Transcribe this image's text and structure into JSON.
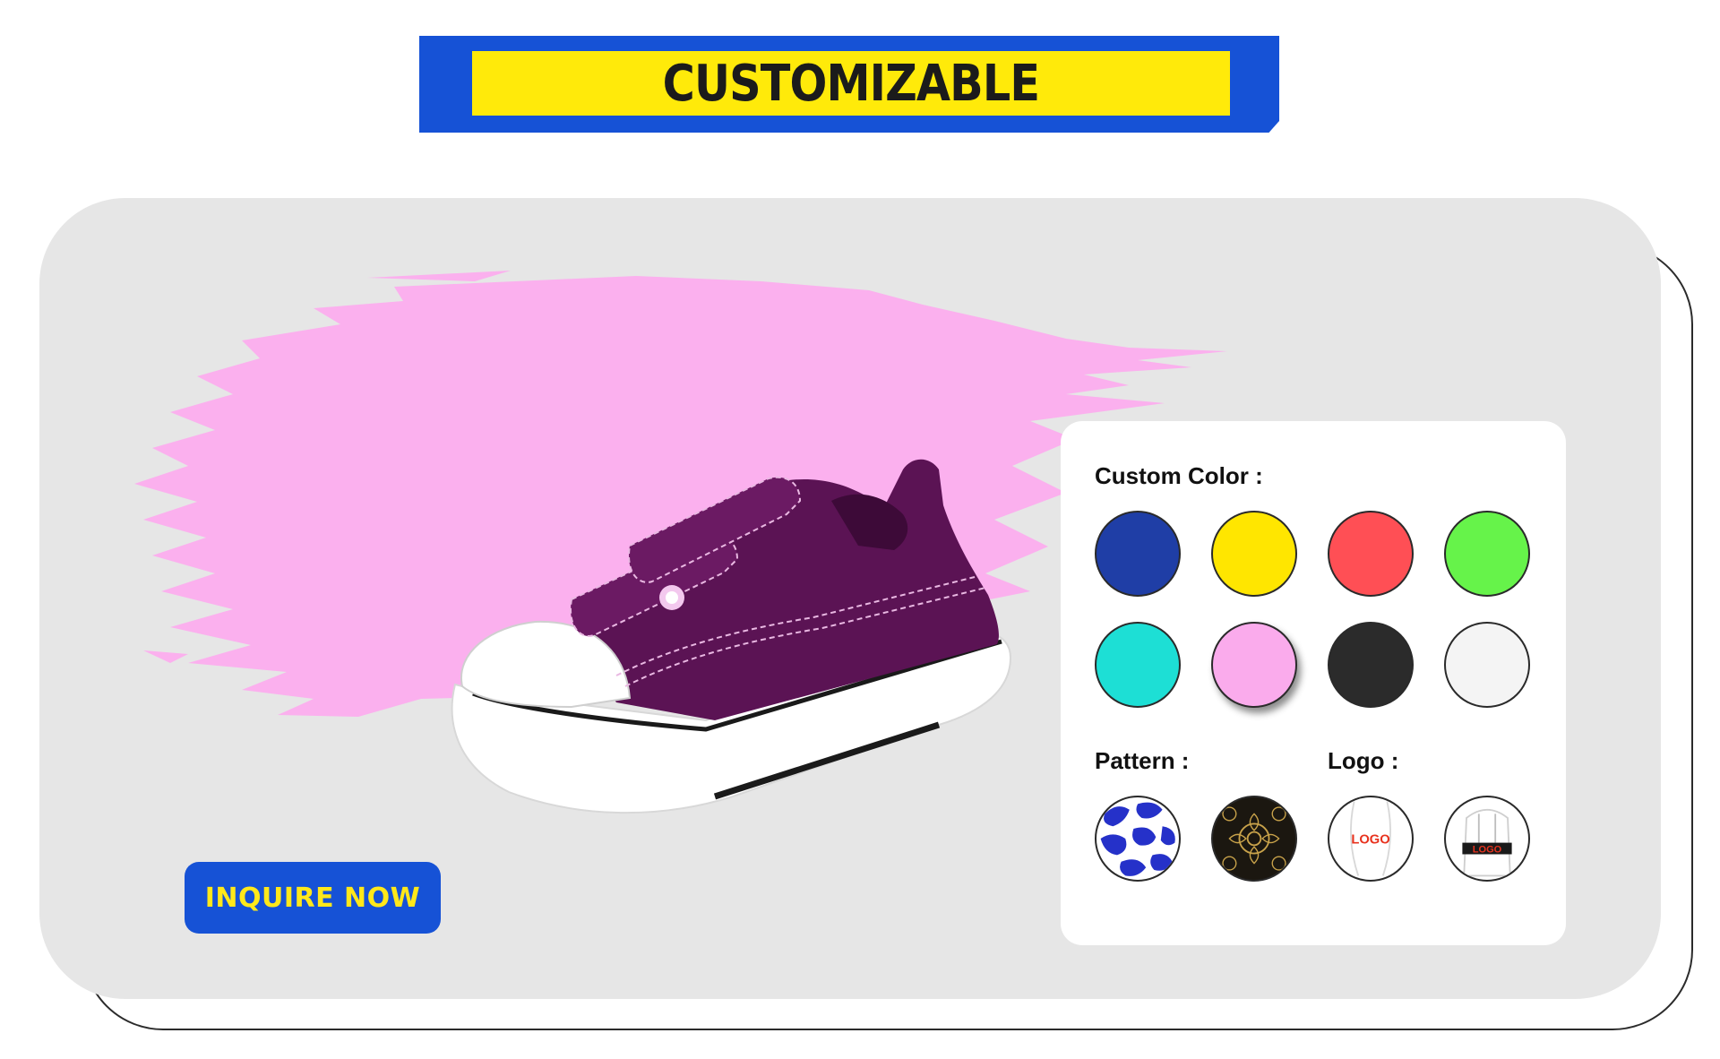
{
  "banner": {
    "title": "CUSTOMIZABLE"
  },
  "actions": {
    "inquire_label": "INQUIRE NOW"
  },
  "options": {
    "color_label": "Custom Color :",
    "colors": [
      {
        "name": "blue",
        "hex": "#1f3ea6"
      },
      {
        "name": "yellow",
        "hex": "#ffe600"
      },
      {
        "name": "red",
        "hex": "#ff4f55"
      },
      {
        "name": "green",
        "hex": "#66f34a"
      },
      {
        "name": "cyan",
        "hex": "#1ddfd5"
      },
      {
        "name": "pink",
        "hex": "#faabec",
        "selected": true
      },
      {
        "name": "black",
        "hex": "#2b2b2b"
      },
      {
        "name": "white",
        "hex": "#f4f4f4"
      }
    ],
    "pattern_label": "Pattern :",
    "patterns": [
      "blue-camo-pattern",
      "black-gold-baroque-pattern"
    ],
    "logo_label": "Logo :",
    "logos": [
      {
        "name": "logo-on-heel",
        "text": "LOGO"
      },
      {
        "name": "logo-on-heel-strap",
        "text": "LOGO"
      }
    ]
  },
  "colors": {
    "banner_blue": "#1652d6",
    "banner_yellow": "#ffea0a",
    "card_bg": "#e6e6e6",
    "brush_pink": "#fbb0ee",
    "shoe_purple": "#5b1354",
    "button_text": "#ffe81a"
  }
}
